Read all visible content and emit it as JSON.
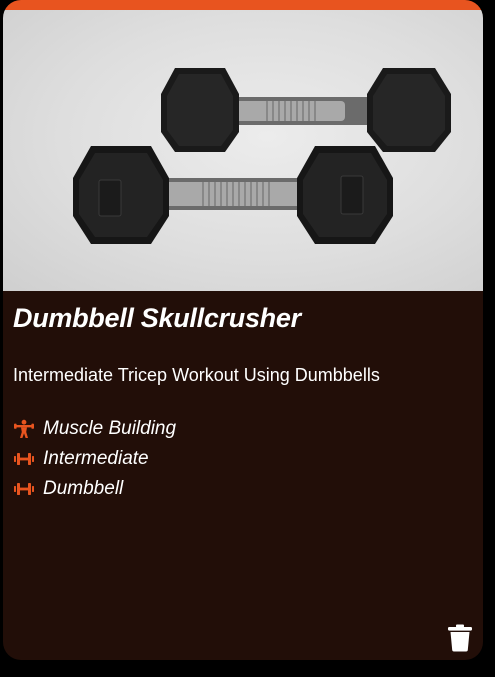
{
  "card": {
    "accent_color": "#e8541f",
    "background_color": "#220e08",
    "title": "Dumbbell Skullcrusher",
    "description": "Intermediate Tricep Workout Using Dumbbells",
    "image_icon": "dumbbells-photo"
  },
  "tags": [
    {
      "icon": "weightlifter-icon",
      "label": "Muscle Building"
    },
    {
      "icon": "dumbbell-icon",
      "label": "Intermediate"
    },
    {
      "icon": "dumbbell-icon",
      "label": "Dumbbell"
    }
  ],
  "actions": {
    "delete_icon": "trash-icon"
  }
}
